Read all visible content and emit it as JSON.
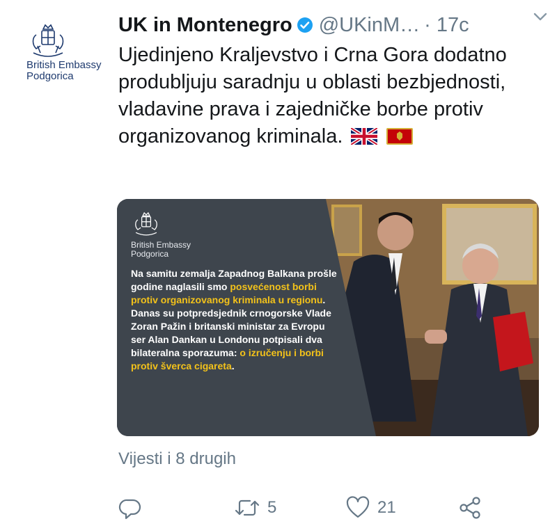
{
  "account": {
    "name": "UK in Montenegro",
    "handle": "@UKinM…",
    "time": "· 17c",
    "avatar_text_line1": "British Embassy",
    "avatar_text_line2": "Podgorica"
  },
  "tweet": {
    "text": "Ujedinjeno Kraljevstvo i Crna Gora dodatno produbljuju saradnju u oblasti bezbjednosti, vladavine prava i zajedničke borbe protiv organizovanog kriminala.",
    "flags": [
      "uk-flag-icon",
      "montenegro-flag-icon"
    ]
  },
  "media": {
    "embassy_line1": "British Embassy",
    "embassy_line2": "Podgorica",
    "text_part1": "Na samitu zemalja Zapadnog Balkana prošle godine naglasili smo ",
    "text_highlight1": "posvećenost borbi protiv organizovanog kriminala u regionu",
    "text_part2": ". Danas su potpredsjednik crnogorske Vlade Zoran Pažin i britanski ministar za Evropu ser Alan Dankan u Londonu potpisali dva bilateralna sporazuma: ",
    "text_highlight2": "o izručenju i borbi protiv šverca cigareta",
    "text_part3": "."
  },
  "more_link": "Vijesti i 8 drugih",
  "actions": {
    "reply_count": "",
    "retweet_count": "5",
    "like_count": "21"
  },
  "colors": {
    "verified": "#1da1f2",
    "highlight": "#f3c21a",
    "secondary_text": "#657786"
  }
}
